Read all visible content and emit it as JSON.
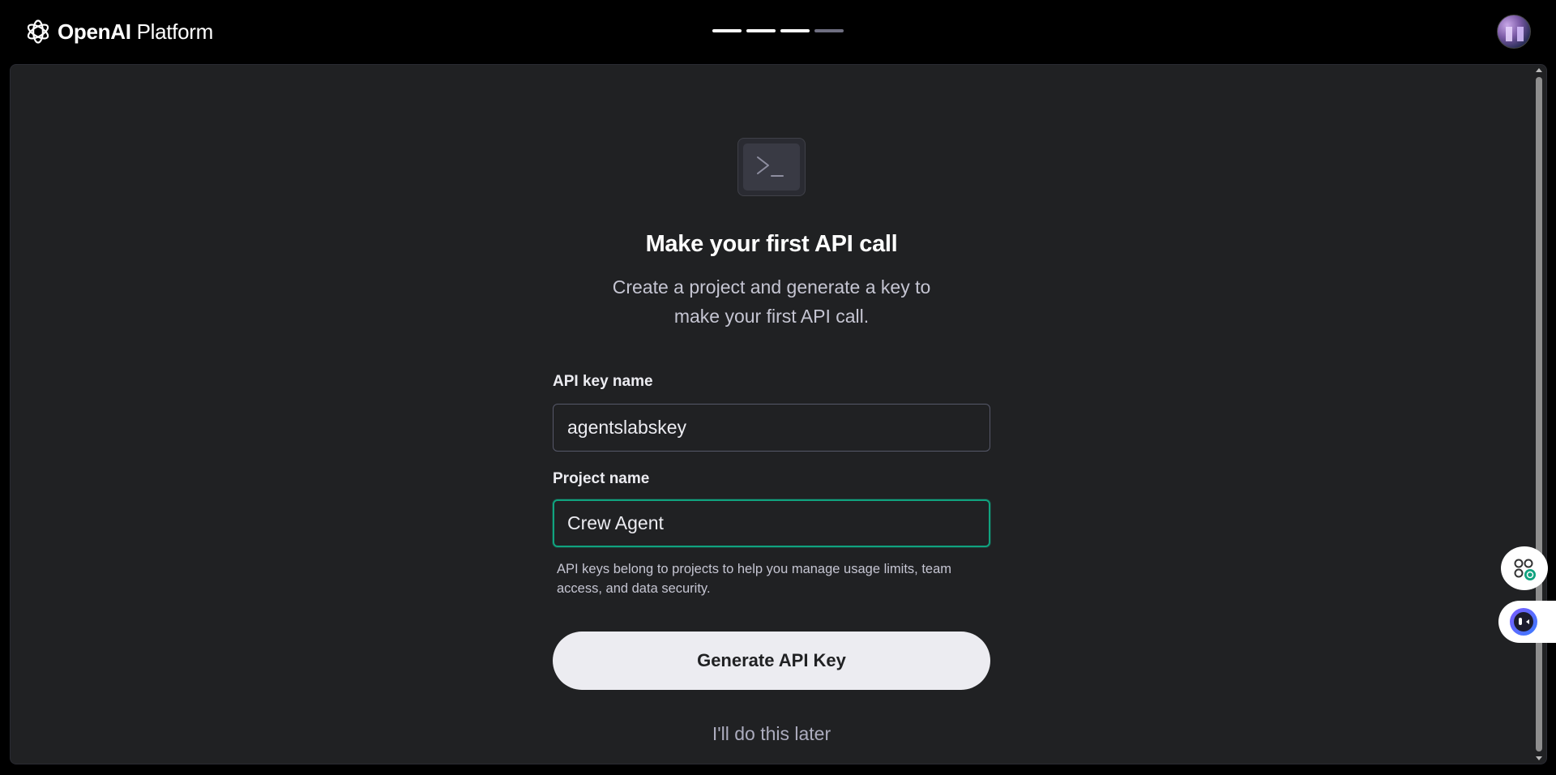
{
  "header": {
    "brand_primary": "OpenAI",
    "brand_secondary": " Platform",
    "progress_steps_total": 4,
    "progress_steps_completed": 3
  },
  "main": {
    "heading": "Make your first API call",
    "subtitle": "Create a project and generate a key to make your first API call.",
    "api_key_label": "API key name",
    "api_key_value": "agentslabskey",
    "project_label": "Project name",
    "project_value": "Crew Agent",
    "help_text": "API keys belong to projects to help you manage usage limits, team access, and data security.",
    "generate_button": "Generate API Key",
    "later_link": "I'll do this later"
  },
  "icons": {
    "logo": "openai-logo-icon",
    "terminal": "terminal-icon",
    "avatar": "user-avatar",
    "extension_a": "shortcut-extension-icon",
    "extension_b": "assistant-extension-icon"
  },
  "colors": {
    "accent": "#10a37f",
    "panel": "#202123",
    "button_bg": "#ececf1"
  }
}
